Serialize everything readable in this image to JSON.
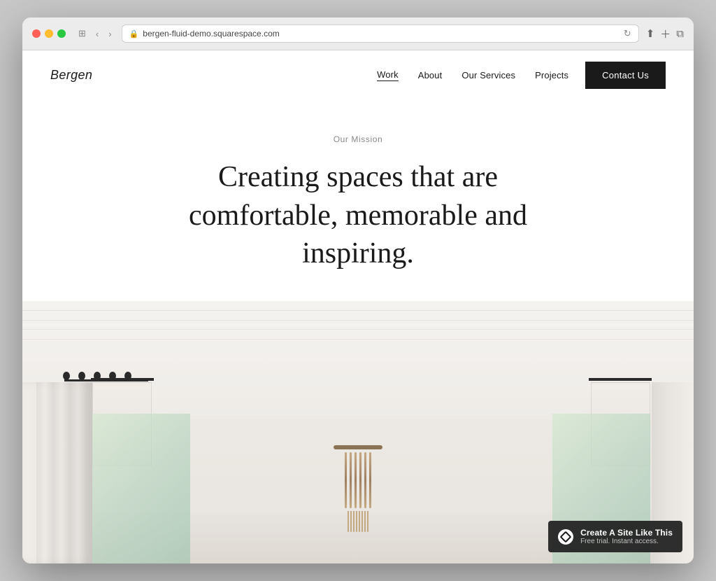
{
  "browser": {
    "url": "bergen-fluid-demo.squarespace.com",
    "lock_icon": "🔒",
    "reload_icon": "↻"
  },
  "nav": {
    "logo": "Bergen",
    "links": [
      {
        "label": "Work",
        "active": true
      },
      {
        "label": "About",
        "active": false
      },
      {
        "label": "Our Services",
        "active": false
      },
      {
        "label": "Projects",
        "active": false
      }
    ],
    "cta": "Contact Us"
  },
  "hero": {
    "label": "Our Mission",
    "title": "Creating spaces that are comfortable, memorable and inspiring."
  },
  "badge": {
    "main": "Create A Site Like This",
    "sub": "Free trial. Instant access."
  }
}
